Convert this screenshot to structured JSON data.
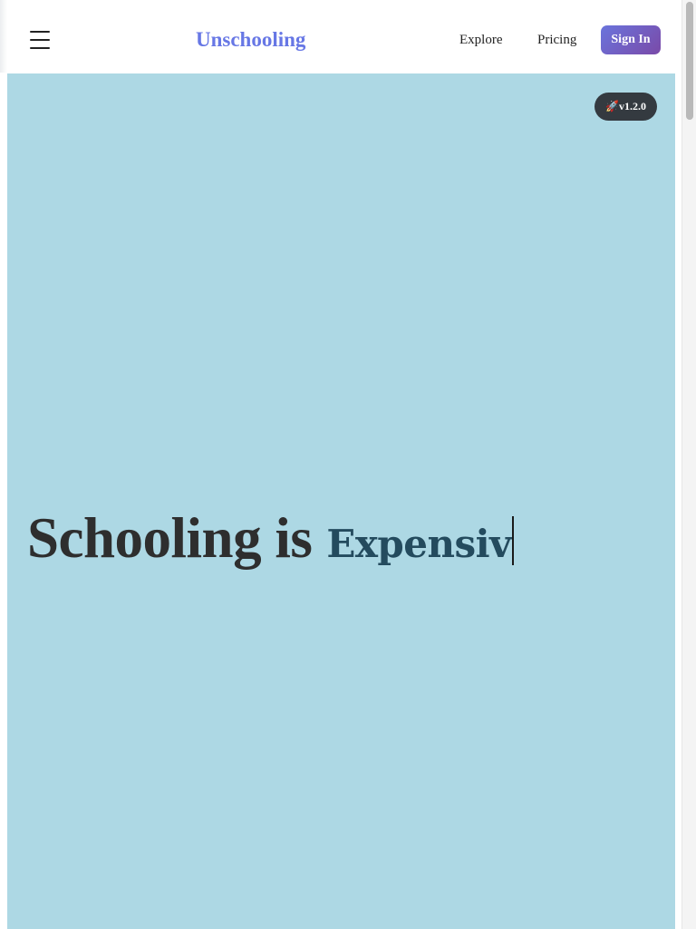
{
  "header": {
    "brand": "Unschooling",
    "nav_links": [
      "Explore",
      "Pricing"
    ],
    "sign_in_label": "Sign In",
    "menu_icon": "hamburger-menu-icon"
  },
  "hero": {
    "version_badge": "🚀v1.2.0",
    "headline_static": "Schooling is",
    "headline_typed": "Expensiv",
    "background_color": "#add8e4"
  },
  "colors": {
    "brand": "#6777e5",
    "sign_in_gradient_start": "#6a74dc",
    "sign_in_gradient_end": "#7a4aa8",
    "badge_background": "#343a40",
    "typed_text": "#244b5e"
  }
}
